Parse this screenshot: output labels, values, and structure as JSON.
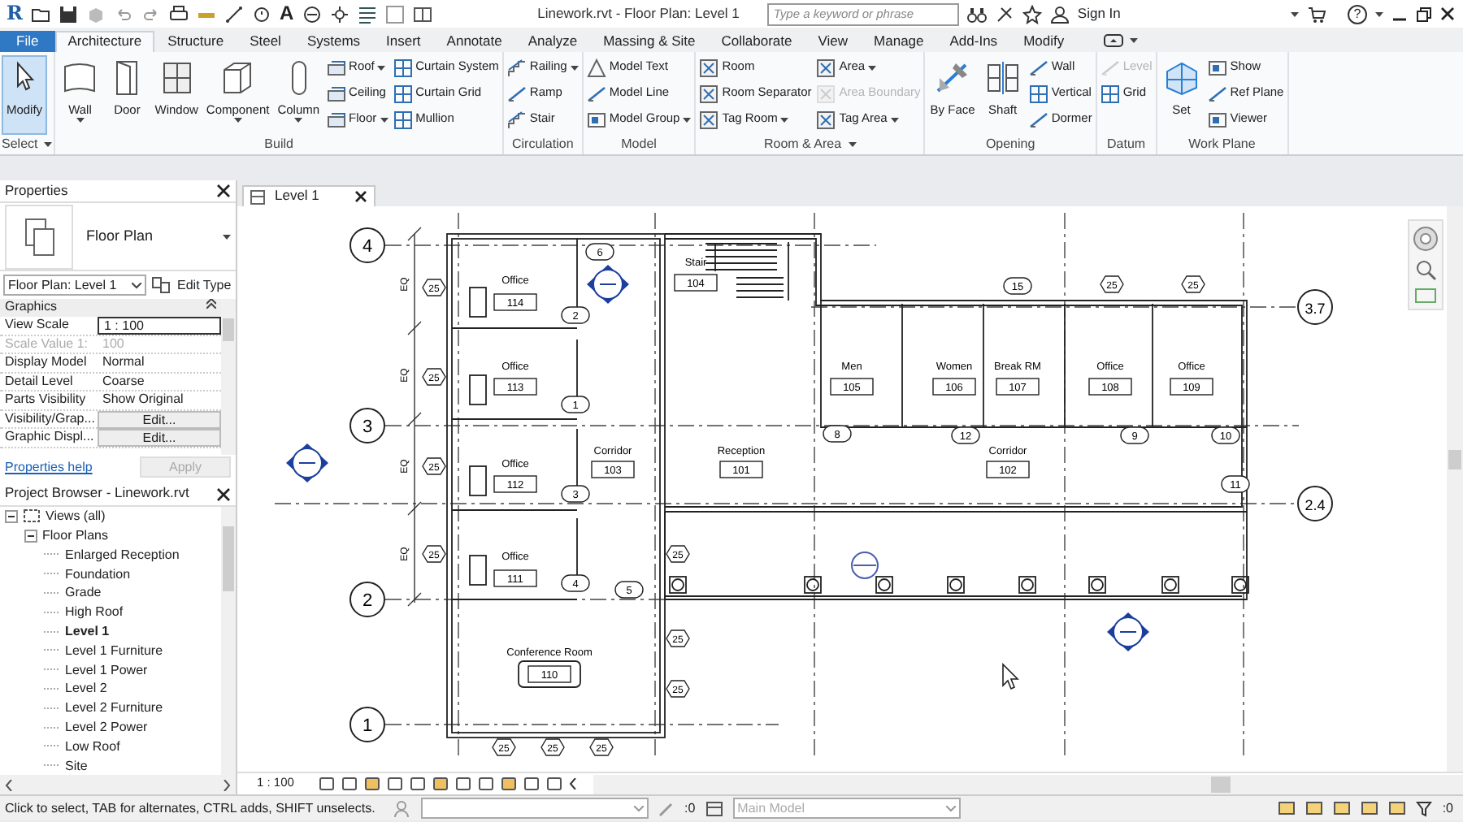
{
  "title_bar": {
    "logo": "R",
    "text_tool": "A",
    "title": "Linework.rvt - Floor Plan: Level 1",
    "search": {
      "placeholder": "Type a keyword or phrase"
    },
    "sign_in": "Sign In",
    "help": "?"
  },
  "tabs": [
    {
      "label": "File",
      "kind": "file",
      "selected": false
    },
    {
      "label": "Architecture",
      "kind": "tab",
      "selected": true
    },
    {
      "label": "Structure",
      "kind": "tab",
      "selected": false
    },
    {
      "label": "Steel",
      "kind": "tab",
      "selected": false
    },
    {
      "label": "Systems",
      "kind": "tab",
      "selected": false
    },
    {
      "label": "Insert",
      "kind": "tab",
      "selected": false
    },
    {
      "label": "Annotate",
      "kind": "tab",
      "selected": false
    },
    {
      "label": "Analyze",
      "kind": "tab",
      "selected": false
    },
    {
      "label": "Massing & Site",
      "kind": "tab",
      "selected": false
    },
    {
      "label": "Collaborate",
      "kind": "tab",
      "selected": false
    },
    {
      "label": "View",
      "kind": "tab",
      "selected": false
    },
    {
      "label": "Manage",
      "kind": "tab",
      "selected": false
    },
    {
      "label": "Add-Ins",
      "kind": "tab",
      "selected": false
    },
    {
      "label": "Modify",
      "kind": "tab",
      "selected": false
    }
  ],
  "ribbon_panels": [
    {
      "label": "Select",
      "dropdown": true,
      "groups": [
        {
          "kind": "large",
          "label": "Modify",
          "selected": true,
          "dropdown": false
        }
      ]
    },
    {
      "label": "Build",
      "dropdown": false,
      "groups": [
        {
          "kind": "large",
          "label": "Wall",
          "selected": false,
          "dropdown": true
        },
        {
          "kind": "large",
          "label": "Door",
          "selected": false,
          "dropdown": false
        },
        {
          "kind": "large",
          "label": "Window",
          "selected": false,
          "dropdown": false
        },
        {
          "kind": "large",
          "label": "Component",
          "selected": false,
          "dropdown": true
        },
        {
          "kind": "large",
          "label": "Column",
          "selected": false,
          "dropdown": true
        },
        {
          "kind": "stack",
          "items": [
            {
              "label": "Roof",
              "dropdown": true,
              "disabled": false
            },
            {
              "label": "Ceiling",
              "dropdown": false,
              "disabled": false
            },
            {
              "label": "Floor",
              "dropdown": true,
              "disabled": false
            }
          ]
        },
        {
          "kind": "stack",
          "items": [
            {
              "label": "Curtain System",
              "dropdown": false,
              "disabled": false
            },
            {
              "label": "Curtain Grid",
              "dropdown": false,
              "disabled": false
            },
            {
              "label": "Mullion",
              "dropdown": false,
              "disabled": false
            }
          ]
        }
      ]
    },
    {
      "label": "Circulation",
      "dropdown": false,
      "groups": [
        {
          "kind": "stack",
          "items": [
            {
              "label": "Railing",
              "dropdown": true,
              "disabled": false
            },
            {
              "label": "Ramp",
              "dropdown": false,
              "disabled": false
            },
            {
              "label": "Stair",
              "dropdown": false,
              "disabled": false
            }
          ]
        }
      ]
    },
    {
      "label": "Model",
      "dropdown": false,
      "groups": [
        {
          "kind": "stack",
          "items": [
            {
              "label": "Model Text",
              "dropdown": false,
              "disabled": false
            },
            {
              "label": "Model Line",
              "dropdown": false,
              "disabled": false
            },
            {
              "label": "Model Group",
              "dropdown": true,
              "disabled": false
            }
          ]
        }
      ]
    },
    {
      "label": "Room & Area",
      "dropdown": true,
      "groups": [
        {
          "kind": "stack",
          "items": [
            {
              "label": "Room",
              "dropdown": false,
              "disabled": false
            },
            {
              "label": "Room Separator",
              "dropdown": false,
              "disabled": false
            },
            {
              "label": "Tag Room",
              "dropdown": true,
              "disabled": false
            }
          ]
        },
        {
          "kind": "stack",
          "items": [
            {
              "label": "Area",
              "dropdown": true,
              "disabled": false
            },
            {
              "label": "Area Boundary",
              "dropdown": false,
              "disabled": true
            },
            {
              "label": "Tag Area",
              "dropdown": true,
              "disabled": false
            }
          ]
        }
      ]
    },
    {
      "label": "Opening",
      "dropdown": false,
      "groups": [
        {
          "kind": "large",
          "label": "By Face",
          "selected": false,
          "dropdown": false
        },
        {
          "kind": "large",
          "label": "Shaft",
          "selected": false,
          "dropdown": false
        },
        {
          "kind": "stack",
          "items": [
            {
              "label": "Wall",
              "dropdown": false,
              "disabled": false
            },
            {
              "label": "Vertical",
              "dropdown": false,
              "disabled": false
            },
            {
              "label": "Dormer",
              "dropdown": false,
              "disabled": false
            }
          ]
        }
      ]
    },
    {
      "label": "Datum",
      "dropdown": false,
      "groups": [
        {
          "kind": "stack",
          "items": [
            {
              "label": "Level",
              "dropdown": false,
              "disabled": true
            },
            {
              "label": "Grid",
              "dropdown": false,
              "disabled": false
            }
          ]
        }
      ]
    },
    {
      "label": "Work Plane",
      "dropdown": false,
      "groups": [
        {
          "kind": "large",
          "label": "Set",
          "selected": false,
          "dropdown": false
        },
        {
          "kind": "stack",
          "items": [
            {
              "label": "Show",
              "dropdown": false,
              "disabled": false
            },
            {
              "label": "Ref Plane",
              "dropdown": false,
              "disabled": false
            },
            {
              "label": "Viewer",
              "dropdown": false,
              "disabled": false
            }
          ]
        }
      ]
    }
  ],
  "properties": {
    "title": "Properties",
    "type_name": "Floor Plan",
    "instance_selector": "Floor Plan: Level 1",
    "edit_type": "Edit Type",
    "group": "Graphics",
    "rows": [
      {
        "name": "View Scale",
        "value": "1 : 100",
        "kind": "input",
        "disabled": false
      },
      {
        "name": "Scale Value    1:",
        "value": "100",
        "kind": "text",
        "disabled": true
      },
      {
        "name": "Display Model",
        "value": "Normal",
        "kind": "text",
        "disabled": false
      },
      {
        "name": "Detail Level",
        "value": "Coarse",
        "kind": "text",
        "disabled": false
      },
      {
        "name": "Parts Visibility",
        "value": "Show Original",
        "kind": "text",
        "disabled": false
      },
      {
        "name": "Visibility/Grap...",
        "value": "Edit...",
        "kind": "button",
        "disabled": false
      },
      {
        "name": "Graphic Displ...",
        "value": "Edit...",
        "kind": "button",
        "disabled": false
      }
    ],
    "help": "Properties help",
    "apply": {
      "label": "Apply",
      "disabled": true
    }
  },
  "project_browser": {
    "title": "Project Browser - Linework.rvt",
    "tree": [
      {
        "label": "Views (all)",
        "expanded": true,
        "children": [
          {
            "label": "Floor Plans",
            "expanded": true,
            "children": [
              {
                "label": "Enlarged Reception",
                "current": false
              },
              {
                "label": "Foundation",
                "current": false
              },
              {
                "label": "Grade",
                "current": false
              },
              {
                "label": "High Roof",
                "current": false
              },
              {
                "label": "Level 1",
                "current": true
              },
              {
                "label": "Level 1 Furniture",
                "current": false
              },
              {
                "label": "Level 1 Power",
                "current": false
              },
              {
                "label": "Level 2",
                "current": false
              },
              {
                "label": "Level 2 Furniture",
                "current": false
              },
              {
                "label": "Level 2 Power",
                "current": false
              },
              {
                "label": "Low Roof",
                "current": false
              },
              {
                "label": "Site",
                "current": false
              }
            ]
          }
        ]
      }
    ]
  },
  "view_tab": {
    "label": "Level 1"
  },
  "floor_plan": {
    "grid_bubbles": [
      "4",
      "3",
      "2",
      "1",
      "3.7",
      "2.4"
    ],
    "rooms": [
      {
        "name": "Office",
        "number": "114"
      },
      {
        "name": "Office",
        "number": "113"
      },
      {
        "name": "Office",
        "number": "112"
      },
      {
        "name": "Office",
        "number": "111"
      },
      {
        "name": "Conference Room",
        "number": "110"
      },
      {
        "name": "Stair",
        "number": "104"
      },
      {
        "name": "Corridor",
        "number": "103"
      },
      {
        "name": "Reception",
        "number": "101"
      },
      {
        "name": "Corridor",
        "number": "102"
      },
      {
        "name": "Men",
        "number": "105"
      },
      {
        "name": "Women",
        "number": "106"
      },
      {
        "name": "Break RM",
        "number": "107"
      },
      {
        "name": "Office",
        "number": "108"
      },
      {
        "name": "Office",
        "number": "109"
      }
    ],
    "door_tags": [
      "6",
      "2",
      "1",
      "3",
      "4",
      "5",
      "15",
      "8",
      "12",
      "9",
      "10",
      "11"
    ],
    "window_tags": [
      "25",
      "25",
      "25",
      "25",
      "25",
      "25",
      "25",
      "25",
      "25",
      "25",
      "25",
      "25"
    ],
    "dimension_labels": [
      "EQ",
      "EQ",
      "EQ",
      "EQ"
    ]
  },
  "view_control_bar": {
    "scale": "1 : 100"
  },
  "status_bar": {
    "message": "Click to select, TAB for alternates, CTRL adds, SHIFT unselects.",
    "selection_count": ":0",
    "workset": "Main Model",
    "filter_count": ":0"
  }
}
